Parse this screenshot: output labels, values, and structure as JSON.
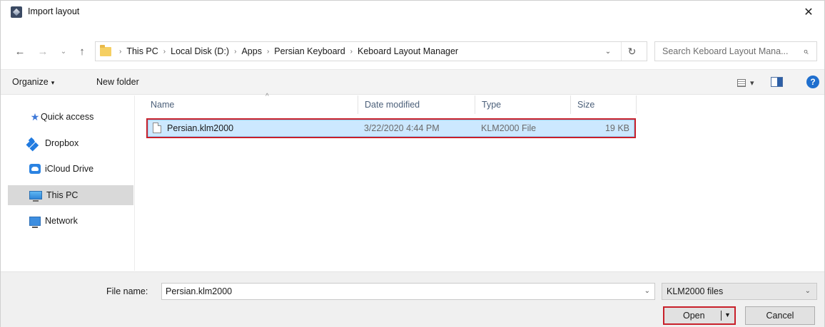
{
  "window": {
    "title": "Import layout",
    "close_glyph": "✕"
  },
  "nav": {
    "back_glyph": "←",
    "forward_glyph": "→",
    "recent_glyph": "⌄",
    "up_glyph": "↑"
  },
  "address": {
    "separator": "›",
    "crumbs": [
      "This PC",
      "Local Disk (D:)",
      "Apps",
      "Persian Keyboard",
      "Keboard Layout Manager"
    ],
    "dropdown_glyph": "⌄",
    "refresh_glyph": "↻"
  },
  "search": {
    "placeholder": "Search Keboard Layout Mana...",
    "icon_glyph": "⌕"
  },
  "toolbar": {
    "organize_label": "Organize",
    "organize_caret": "▾",
    "new_folder_label": "New folder",
    "view_caret": "▾",
    "help_glyph": "?"
  },
  "sidebar": {
    "items": [
      {
        "label": "Quick access",
        "icon": "star-icon"
      },
      {
        "label": "Dropbox",
        "icon": "dropbox-icon"
      },
      {
        "label": "iCloud Drive",
        "icon": "icloud-icon"
      },
      {
        "label": "This PC",
        "icon": "pc-icon",
        "selected": true
      },
      {
        "label": "Network",
        "icon": "network-icon"
      }
    ]
  },
  "files": {
    "sort_glyph": "^",
    "columns": [
      "Name",
      "Date modified",
      "Type",
      "Size"
    ],
    "rows": [
      {
        "name": "Persian.klm2000",
        "date": "3/22/2020 4:44 PM",
        "type": "KLM2000 File",
        "size": "19 KB"
      }
    ]
  },
  "bottom": {
    "file_name_label": "File name:",
    "file_name_value": "Persian.klm2000",
    "file_name_caret": "⌄",
    "filter_value": "KLM2000 files",
    "filter_caret": "⌄",
    "open_label": "Open",
    "open_caret": "▼",
    "cancel_label": "Cancel"
  },
  "colors": {
    "selection_fill": "#cce8ff",
    "highlight_outline": "#c8202a",
    "accent": "#1f6fce"
  }
}
